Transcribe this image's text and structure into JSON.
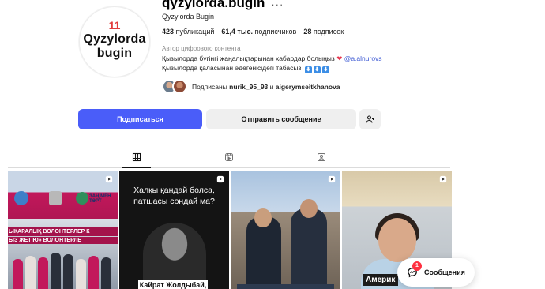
{
  "profile": {
    "avatar_mark": "11",
    "avatar_line1": "Qyzylorda",
    "avatar_line2": "bugin",
    "username": "qyzylorda.bugin",
    "more_icon": "ellipsis-icon",
    "full_name": "Qyzylorda Bugin",
    "stats": {
      "posts_count": "423",
      "posts_label": "публикаций",
      "followers_count": "61,4 тыс.",
      "followers_label": "подписчиков",
      "following_count": "28",
      "following_label": "подписок"
    },
    "category": "Автор цифрового контента",
    "bio_line1_text": "Қызылорда бүгінгі жаңалықтарынан хабардар болыңыз",
    "bio_line1_heart": "❤",
    "bio_line1_mention": "@a.alnurovs",
    "bio_line2_text": "Қызылорда қаласынан әдегенісідегі табасыз",
    "followed_by_prefix": "Подписаны",
    "followed_by_user1": "nurik_95_93",
    "followed_by_and": "и",
    "followed_by_user2": "aigerymseitkhanova"
  },
  "actions": {
    "follow_label": "Подписаться",
    "message_label": "Отправить сообщение",
    "add_user_icon": "add-user-icon"
  },
  "tabs": [
    {
      "name": "posts",
      "icon": "grid-icon",
      "active": true
    },
    {
      "name": "reels",
      "icon": "reels-icon",
      "active": false
    },
    {
      "name": "tagged",
      "icon": "tagged-icon",
      "active": false
    }
  ],
  "grid": {
    "tile1_banner1": "ЫҚАРАЛЫҚ ВОЛОНТЕРЛЕР К",
    "tile1_banner2": "БІЗ ЖЕТІЮ» ВОЛОНТЕРЛЕ",
    "tile1_sign": "ЗАҢ МЕН ТӘРТ",
    "tile2_question": "Халқы қандай болса, патшасы сондай ма?",
    "tile2_name": "Кайрат Жолдыбай,",
    "tile4_caption": "Америк"
  },
  "messages_pill": {
    "label": "Сообщения",
    "badge": "1"
  },
  "colors": {
    "accent": "#4a5df9",
    "badge": "#ff3040",
    "mention": "#3f5bd4"
  }
}
